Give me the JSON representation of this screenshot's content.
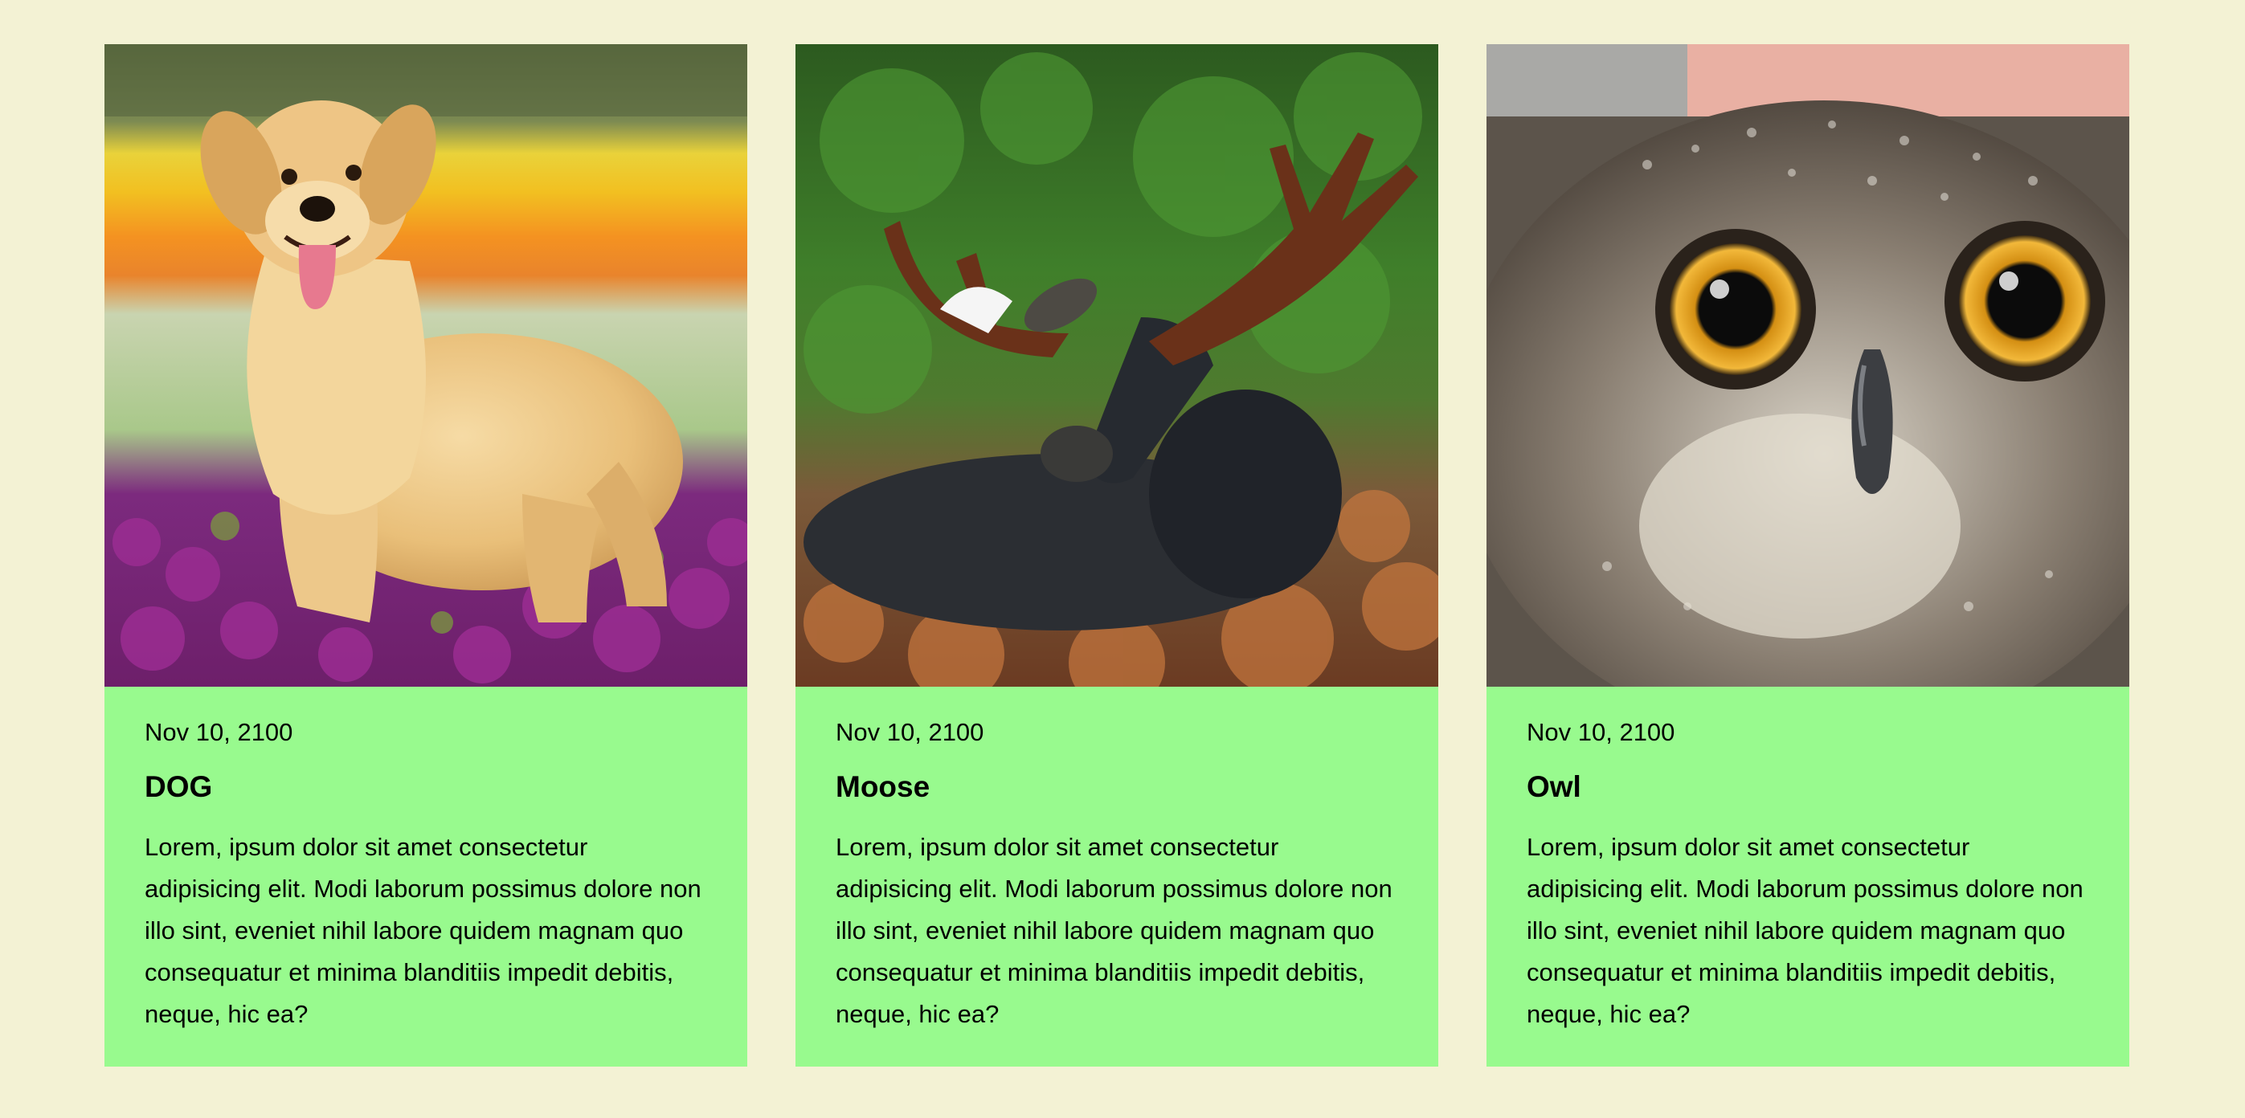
{
  "cards": [
    {
      "image_subject": "golden-retriever-in-flower-field",
      "date": "Nov 10, 2100",
      "title": "DOG",
      "text": "Lorem, ipsum dolor sit amet consectetur adipisicing elit. Modi laborum possimus dolore non illo sint, eveniet nihil labore quidem magnam quo consequatur et minima blanditiis impedit debitis, neque, hic ea?"
    },
    {
      "image_subject": "moose-resting-in-heather",
      "date": "Nov 10, 2100",
      "title": "Moose",
      "text": "Lorem, ipsum dolor sit amet consectetur adipisicing elit. Modi laborum possimus dolore non illo sint, eveniet nihil labore quidem magnam quo consequatur et minima blanditiis impedit debitis, neque, hic ea?"
    },
    {
      "image_subject": "owl-face-closeup",
      "date": "Nov 10, 2100",
      "title": "Owl",
      "text": "Lorem, ipsum dolor sit amet consectetur adipisicing elit. Modi laborum possimus dolore non illo sint, eveniet nihil labore quidem magnam quo consequatur et minima blanditiis impedit debitis, neque, hic ea?"
    }
  ],
  "colors": {
    "page_background": "#f3f2d4",
    "card_background": "#98fa8e",
    "text": "#000000"
  }
}
